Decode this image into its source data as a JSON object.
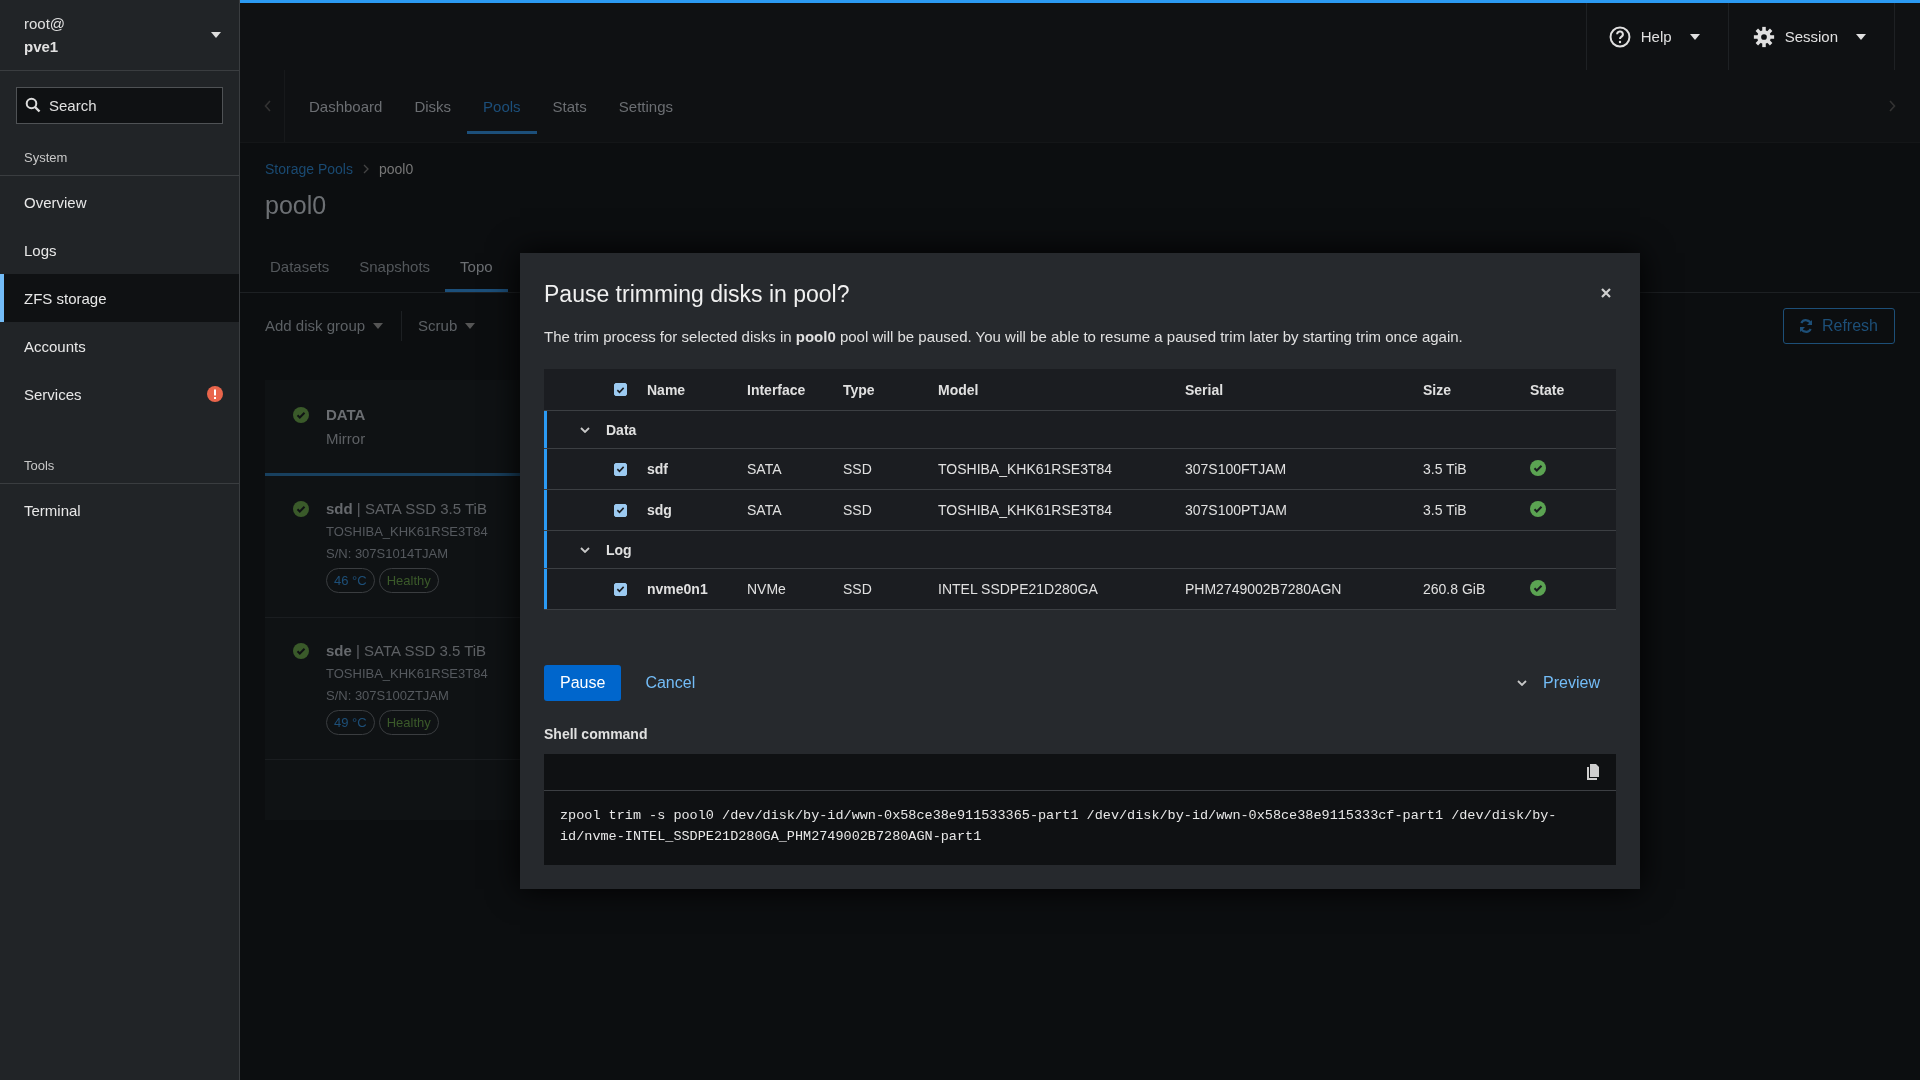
{
  "sidebar": {
    "user": "root@",
    "host": "pve1",
    "search": {
      "placeholder": "Search"
    },
    "sections": [
      {
        "title": "System",
        "items": [
          {
            "label": "Overview",
            "selected": false,
            "alert": false
          },
          {
            "label": "Logs",
            "selected": false,
            "alert": false
          },
          {
            "label": "ZFS storage",
            "selected": true,
            "alert": false
          },
          {
            "label": "Accounts",
            "selected": false,
            "alert": false
          },
          {
            "label": "Services",
            "selected": false,
            "alert": true
          }
        ]
      },
      {
        "title": "Tools",
        "items": [
          {
            "label": "Terminal",
            "selected": false,
            "alert": false
          }
        ]
      }
    ]
  },
  "topbar": {
    "help": "Help",
    "session": "Session"
  },
  "nav_tabs": [
    {
      "label": "Dashboard",
      "selected": false
    },
    {
      "label": "Disks",
      "selected": false
    },
    {
      "label": "Pools",
      "selected": true
    },
    {
      "label": "Stats",
      "selected": false
    },
    {
      "label": "Settings",
      "selected": false
    }
  ],
  "breadcrumb": [
    "Storage Pools",
    "pool0"
  ],
  "page_title": "pool0",
  "sub_tabs": [
    {
      "label": "Datasets",
      "selected": false
    },
    {
      "label": "Snapshots",
      "selected": false
    },
    {
      "label": "Topo",
      "selected": true
    }
  ],
  "toolbar": {
    "add_disk_group": "Add disk group",
    "scrub": "Scrub",
    "refresh": "Refresh"
  },
  "topology": [
    {
      "kind": "group",
      "name": "DATA",
      "subtitle": "Mirror",
      "healthy": true,
      "selected": true
    },
    {
      "kind": "disk",
      "name": "sdd",
      "summary": "| SATA SSD 3.5 TiB",
      "model": "TOSHIBA_KHK61RSE3T84",
      "serial": "S/N: 307S1014TJAM",
      "temperature": "46 °C",
      "health": "Healthy",
      "healthy": true
    },
    {
      "kind": "disk",
      "name": "sde",
      "summary": "| SATA SSD 3.5 TiB",
      "model": "TOSHIBA_KHK61RSE3T84",
      "serial": "S/N: 307S100ZTJAM",
      "temperature": "49 °C",
      "health": "Healthy",
      "healthy": true
    }
  ],
  "dialog": {
    "title": "Pause trimming disks in pool?",
    "description": "The trim process for selected disks in **pool0** pool will be paused. You will be able to resume a paused trim later by starting trim once again.",
    "table": {
      "all_checked": true,
      "columns": [
        "Name",
        "Interface",
        "Type",
        "Model",
        "Serial",
        "Size",
        "State"
      ],
      "groups": [
        {
          "name": "Data",
          "expanded": true,
          "disks": [
            {
              "checked": true,
              "name": "sdf",
              "interface": "SATA",
              "type": "SSD",
              "model": "TOSHIBA_KHK61RSE3T84",
              "serial": "307S100FTJAM",
              "size": "3.5 TiB",
              "ok": true
            },
            {
              "checked": true,
              "name": "sdg",
              "interface": "SATA",
              "type": "SSD",
              "model": "TOSHIBA_KHK61RSE3T84",
              "serial": "307S100PTJAM",
              "size": "3.5 TiB",
              "ok": true
            }
          ]
        },
        {
          "name": "Log",
          "expanded": true,
          "disks": [
            {
              "checked": true,
              "name": "nvme0n1",
              "interface": "NVMe",
              "type": "SSD",
              "model": "INTEL SSDPE21D280GA",
              "serial": "PHM2749002B7280AGN",
              "size": "260.8 GiB",
              "ok": true
            }
          ]
        }
      ]
    },
    "pause": "Pause",
    "cancel": "Cancel",
    "preview": {
      "label": "Preview",
      "expanded": true
    },
    "shell_label": "Shell command",
    "command": "zpool trim -s pool0 /dev/disk/by-id/wwn-0x58ce38e911533365-part1 /dev/disk/by-id/wwn-0x58ce38e9115333cf-part1 /dev/disk/by-id/nvme-INTEL_SSDPE21D280GA_PHM2749002B7280AGN-part1"
  }
}
